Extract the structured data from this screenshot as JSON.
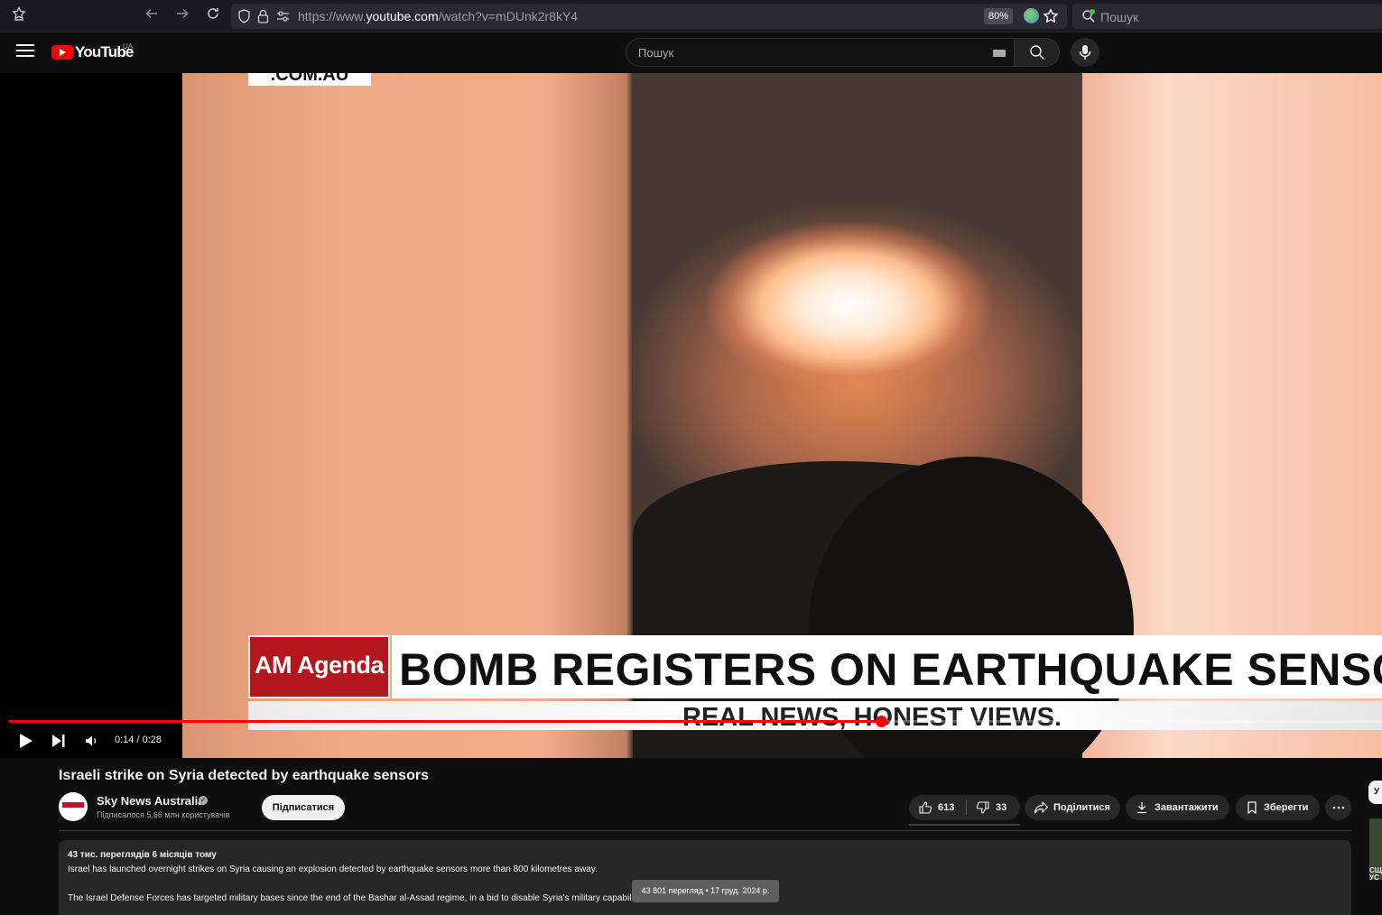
{
  "browser": {
    "url_prefix": "https://www.",
    "url_host": "youtube.com",
    "url_path": "/watch?v=mDUnk2r8kY4",
    "zoom": "80%",
    "search_placeholder": "Пошук"
  },
  "header": {
    "logo_text": "YouTube",
    "country_code": "UA",
    "search_placeholder": "Пошук"
  },
  "player": {
    "overlay_site": ".COM.AU",
    "overlay_show": "AM Agenda",
    "overlay_headline": "BOMB REGISTERS ON EARTHQUAKE SENSORS",
    "overlay_tagline": "REAL NEWS, HONEST VIEWS.",
    "time": "0:14 / 0:28",
    "progress_fraction": 0.635
  },
  "video": {
    "title": "Israeli strike on Syria detected by earthquake sensors"
  },
  "channel": {
    "name": "Sky News Australia",
    "subscribers": "Підписалося 5,66 млн користувачів",
    "subscribe_label": "Підписатися"
  },
  "actions": {
    "likes": "613",
    "dislikes": "33",
    "share_label": "Поділитися",
    "download_label": "Завантажити",
    "save_label": "Зберегти"
  },
  "description": {
    "meta": "43 тис. переглядів  6 місяців тому",
    "line1": "Israel has launched overnight strikes on Syria causing an explosion detected by earthquake sensors more than 800 kilometres away.",
    "line2": "The Israel Defense Forces has targeted military bases since the end of the Bashar al-Assad regime, in a bid to disable Syria's military capability.",
    "tooltip": "43 801 перегляд • 17 груд. 2024 р."
  },
  "sidebar": {
    "top_chip": "У",
    "caption": "СЩ УС"
  }
}
